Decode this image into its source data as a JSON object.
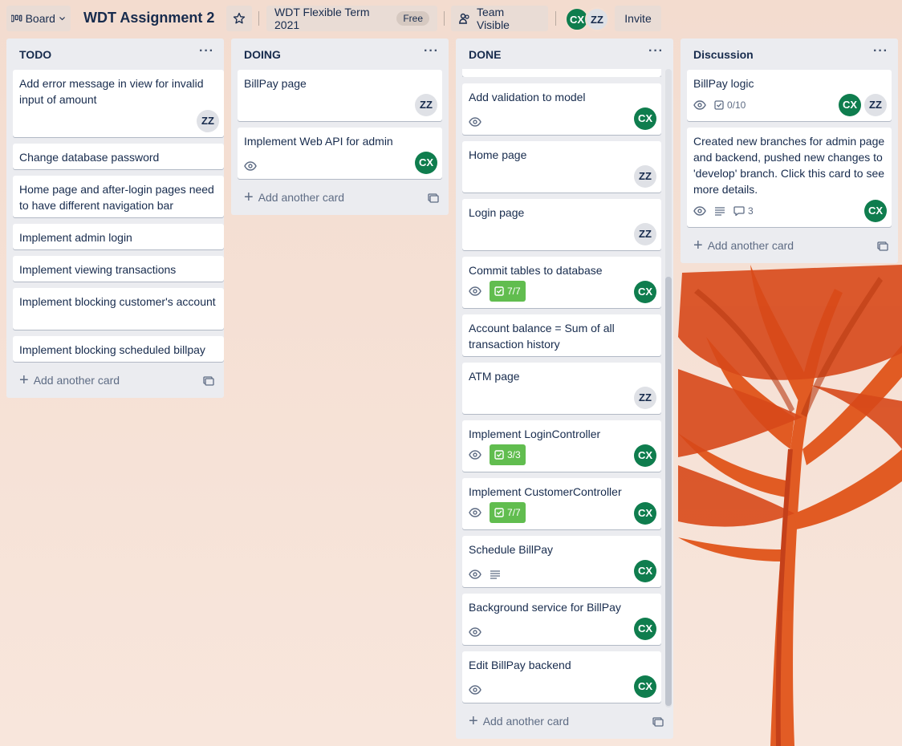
{
  "colors": {
    "member_cx": "#0f7d4e",
    "member_zz": "#dfe1e6",
    "label_green": "#61bd4f",
    "list_bg": "#ebecf0"
  },
  "header": {
    "view_switcher": "Board",
    "board_title": "WDT Assignment 2",
    "workspace": "WDT Flexible Term 2021",
    "plan_badge": "Free",
    "visibility": "Team Visible",
    "members": [
      "CX",
      "ZZ"
    ],
    "invite": "Invite"
  },
  "add_card_label": "+ Add another card",
  "add_card_text": "Add another card",
  "lists": [
    {
      "title": "TODO",
      "cards": [
        {
          "title": "Add error message in view for invalid input of amount",
          "members": [
            "ZZ"
          ]
        },
        {
          "title": "Change database password"
        },
        {
          "title": "Home page and after-login pages need to have different navigation bar"
        },
        {
          "title": "Implement admin login"
        },
        {
          "title": "Implement viewing transactions"
        },
        {
          "title": "Implement blocking customer's account"
        },
        {
          "title": "Implement blocking scheduled billpay"
        }
      ]
    },
    {
      "title": "DOING",
      "cards": [
        {
          "title": "BillPay page",
          "members": [
            "ZZ"
          ]
        },
        {
          "title": "Implement Web API for admin",
          "watching": true,
          "members": [
            "CX"
          ]
        }
      ]
    },
    {
      "title": "DONE",
      "cards": [
        {
          "title": "Add validation to model",
          "watching": true,
          "members": [
            "CX"
          ]
        },
        {
          "title": "Home page",
          "members": [
            "ZZ"
          ]
        },
        {
          "title": "Login page",
          "members": [
            "ZZ"
          ]
        },
        {
          "title": "Commit tables to database",
          "watching": true,
          "checklist": "7/7",
          "members": [
            "CX"
          ]
        },
        {
          "title": "Account balance = Sum of all transaction history"
        },
        {
          "title": "ATM page",
          "members": [
            "ZZ"
          ]
        },
        {
          "title": "Implement LoginController",
          "watching": true,
          "checklist": "3/3",
          "members": [
            "CX"
          ]
        },
        {
          "title": "Implement CustomerController",
          "watching": true,
          "checklist": "7/7",
          "members": [
            "CX"
          ]
        },
        {
          "title": "Schedule BillPay",
          "watching": true,
          "description": true,
          "members": [
            "CX"
          ]
        },
        {
          "title": "Background service for BillPay",
          "watching": true,
          "members": [
            "CX"
          ]
        },
        {
          "title": "Edit BillPay backend",
          "watching": true,
          "members": [
            "CX"
          ]
        }
      ]
    },
    {
      "title": "Discussion",
      "cards": [
        {
          "title": "BillPay logic",
          "watching": true,
          "checklist": "0/10",
          "members": [
            "CX",
            "ZZ"
          ]
        },
        {
          "title": "Created new branches for admin page and backend, pushed new changes to 'develop' branch. Click this card to see more details.",
          "watching": true,
          "description": true,
          "comments": "3",
          "members": [
            "CX"
          ]
        }
      ]
    }
  ]
}
